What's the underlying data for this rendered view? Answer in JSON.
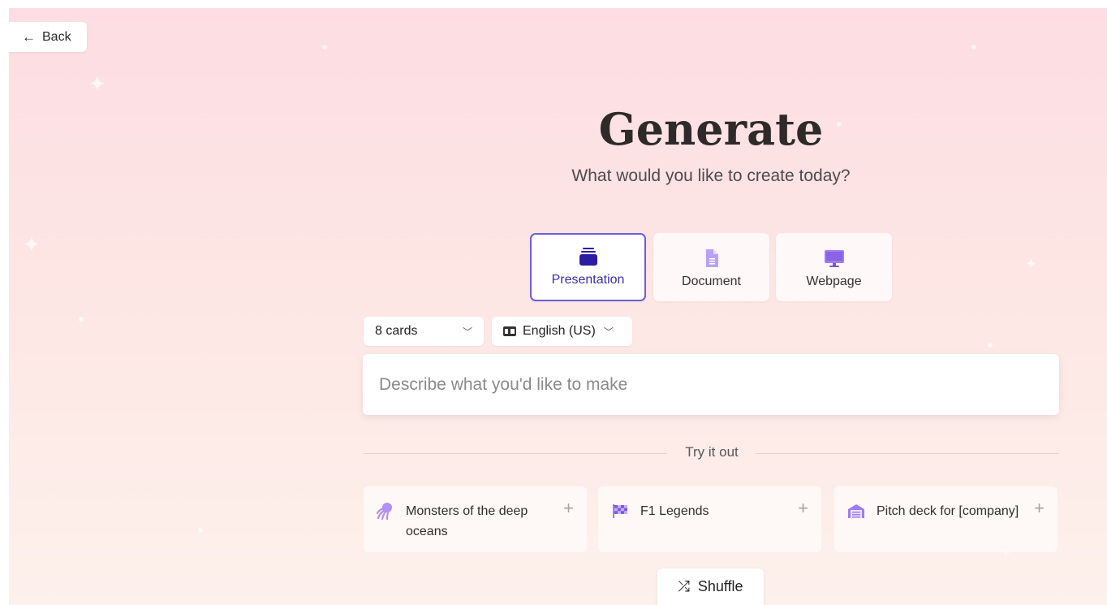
{
  "back": {
    "label": "Back"
  },
  "header": {
    "title": "Generate",
    "subtitle": "What would you like to create today?"
  },
  "types": [
    {
      "label": "Presentation",
      "selected": true
    },
    {
      "label": "Document",
      "selected": false
    },
    {
      "label": "Webpage",
      "selected": false
    }
  ],
  "options": {
    "cards": "8 cards",
    "language": "English (US)"
  },
  "prompt": {
    "placeholder": "Describe what you'd like to make"
  },
  "try_it_out": {
    "label": "Try it out",
    "suggestions": [
      {
        "text": "Monsters of the deep oceans",
        "icon": "octopus-icon"
      },
      {
        "text": "F1 Legends",
        "icon": "checkered-flag-icon"
      },
      {
        "text": "Pitch deck for [company]",
        "icon": "building-icon"
      }
    ]
  },
  "shuffle": {
    "label": "Shuffle"
  },
  "colors": {
    "accent": "#6a5fd6",
    "accent_dark": "#3b2fa8",
    "icon_purple": "#a07cf0"
  }
}
